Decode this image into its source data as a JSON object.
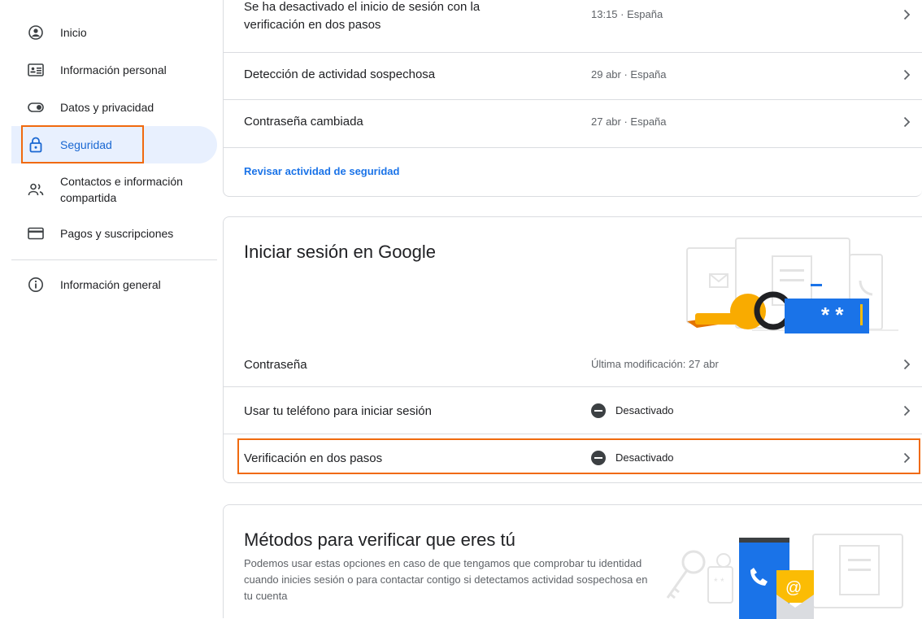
{
  "sidebar": {
    "items": [
      {
        "label": "Inicio",
        "icon": "account-circle-icon"
      },
      {
        "label": "Información personal",
        "icon": "id-card-icon"
      },
      {
        "label": "Datos y privacidad",
        "icon": "toggle-icon"
      },
      {
        "label": "Seguridad",
        "icon": "lock-icon",
        "active": true
      },
      {
        "label": "Contactos e información compartida",
        "icon": "people-icon"
      },
      {
        "label": "Pagos y suscripciones",
        "icon": "credit-card-icon"
      },
      {
        "label": "Información general",
        "icon": "info-icon"
      }
    ]
  },
  "activity": {
    "events": [
      {
        "title": "Se ha desactivado el inicio de sesión con la verificación en dos pasos",
        "meta": "13:15 · España"
      },
      {
        "title": "Detección de actividad sospechosa",
        "meta": "29 abr · España"
      },
      {
        "title": "Contraseña cambiada",
        "meta": "27 abr · España"
      }
    ],
    "review_link": "Revisar actividad de seguridad"
  },
  "signin": {
    "title": "Iniciar sesión en Google",
    "rows": [
      {
        "title": "Contraseña",
        "value": "Última modificación: 27 abr"
      },
      {
        "title": "Usar tu teléfono para iniciar sesión",
        "value": "Desactivado"
      },
      {
        "title": "Verificación en dos pasos",
        "value": "Desactivado"
      }
    ],
    "illustration_text": "* *"
  },
  "verify": {
    "title": "Métodos para verificar que eres tú",
    "description": "Podemos usar estas opciones en caso de que tengamos que comprobar tu identidad cuando inicies sesión o para contactar contigo si detectamos actividad sospechosa en tu cuenta",
    "illustration_text": "@"
  },
  "colors": {
    "accent": "#1a73e8",
    "highlight": "#f06a0f",
    "active_bg": "#e8f0fe"
  }
}
